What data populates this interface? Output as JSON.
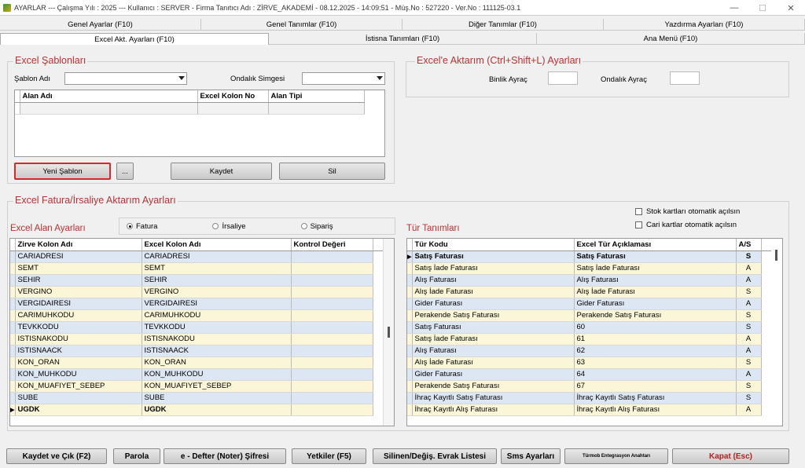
{
  "window": {
    "title": "AYARLAR  ---  Çalışma Yılı : 2025  ---  Kullanıcı : SERVER - Firma Tanıtıcı Adı : ZİRVE_AKADEMİ - 08.12.2025 - 14:09:51 - Müş.No : 527220 - Ver.No : 111125-03.1",
    "minimize": "—",
    "maximize": "☐",
    "close": "✕"
  },
  "tabs_row1": [
    "Genel Ayarlar (F10)",
    "Genel Tanımlar (F10)",
    "Diğer Tanımlar (F10)",
    "Yazdırma Ayarları (F10)"
  ],
  "tabs_row2": [
    "Excel Akt. Ayarları (F10)",
    "İstisna Tanımları (F10)",
    "Ana Menü (F10)"
  ],
  "templates": {
    "title": "Excel Şablonları",
    "template_name_label": "Şablon Adı",
    "decimal_symbol_label": "Ondalık Simgesi",
    "template_name_value": "",
    "decimal_symbol_value": "",
    "columns": [
      "Alan Adı",
      "Excel Kolon No",
      "Alan Tipi"
    ],
    "new_button": "Yeni Şablon",
    "browse_button": "...",
    "save_button": "Kaydet",
    "delete_button": "Sil"
  },
  "transfer": {
    "title": "Excel'e Aktarım (Ctrl+Shift+L) Ayarları",
    "thousands_label": "Binlik Ayraç",
    "decimal_label": "Ondalık Ayraç",
    "thousands_value": "",
    "decimal_value": ""
  },
  "invoice": {
    "title": "Excel Fatura/İrsaliye Aktarım Ayarları",
    "field_settings_label": "Excel Alan Ayarları",
    "radio": [
      "Fatura",
      "İrsaliye",
      "Sipariş"
    ],
    "radio_selected": 0,
    "field_columns": [
      "Zirve Kolon Adı",
      "Excel Kolon Adı",
      "Kontrol Değeri"
    ],
    "field_rows": [
      [
        "CARIADRESI",
        "CARIADRESI",
        ""
      ],
      [
        "SEMT",
        "SEMT",
        ""
      ],
      [
        "SEHIR",
        "SEHIR",
        ""
      ],
      [
        "VERGINO",
        "VERGINO",
        ""
      ],
      [
        "VERGIDAIRESI",
        "VERGIDAIRESI",
        ""
      ],
      [
        "CARIMUHKODU",
        "CARIMUHKODU",
        ""
      ],
      [
        "TEVKKODU",
        "TEVKKODU",
        ""
      ],
      [
        "ISTISNAKODU",
        "ISTISNAKODU",
        ""
      ],
      [
        "ISTISNAACK",
        "ISTISNAACK",
        ""
      ],
      [
        "KON_ORAN",
        "KON_ORAN",
        ""
      ],
      [
        "KON_MUHKODU",
        "KON_MUHKODU",
        ""
      ],
      [
        "KON_MUAFIYET_SEBEP",
        "KON_MUAFIYET_SEBEP",
        ""
      ],
      [
        "SUBE",
        "SUBE",
        ""
      ],
      [
        "UGDK",
        "UGDK",
        ""
      ]
    ],
    "stock_auto_label": "Stok kartları otomatik açılsın",
    "account_auto_label": "Cari kartlar otomatik açılsın",
    "type_defs_label": "Tür Tanımları",
    "type_columns": [
      "Tür Kodu",
      "Excel Tür Açıklaması",
      "A/S"
    ],
    "type_rows": [
      [
        "Satış Faturası",
        "Satış Faturası",
        "S"
      ],
      [
        "Satış İade Faturası",
        "Satış İade Faturası",
        "A"
      ],
      [
        "Alış Faturası",
        "Alış Faturası",
        "A"
      ],
      [
        "Alış İade Faturası",
        "Alış İade Faturası",
        "S"
      ],
      [
        "Gider Faturası",
        "Gider Faturası",
        "A"
      ],
      [
        "Perakende Satış Faturası",
        "Perakende Satış Faturası",
        "S"
      ],
      [
        "Satış Faturası",
        "60",
        "S"
      ],
      [
        "Satış İade Faturası",
        "61",
        "A"
      ],
      [
        "Alış Faturası",
        "62",
        "A"
      ],
      [
        "Alış İade Faturası",
        "63",
        "S"
      ],
      [
        "Gider Faturası",
        "64",
        "A"
      ],
      [
        "Perakende Satış Faturası",
        "67",
        "S"
      ],
      [
        "İhraç Kayıtlı Satış Faturası",
        "İhraç Kayıtlı Satış Faturası",
        "S"
      ],
      [
        "İhraç Kayıtlı Alış Faturası",
        "İhraç Kayıtlı Alış Faturası",
        "A"
      ]
    ]
  },
  "bottom": {
    "save_exit": "Kaydet ve Çık (F2)",
    "password": "Parola",
    "edefter_password": "e - Defter (Noter) Şifresi",
    "permissions": "Yetkiler (F5)",
    "deleted_list": "Silinen/Değiş. Evrak Listesi",
    "sms_settings": "Sms Ayarları",
    "turmob_keys": "Türmob Entegrasyon Anahtarı",
    "close": "Kapat (Esc)"
  }
}
